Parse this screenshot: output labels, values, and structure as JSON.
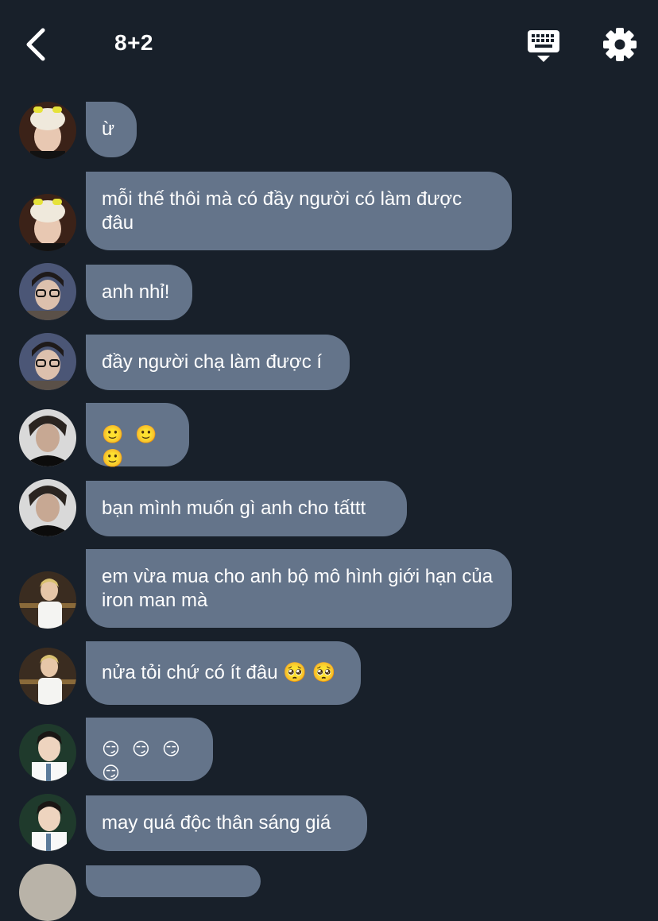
{
  "header": {
    "title": "8+2"
  },
  "messages": [
    {
      "text": "ừ",
      "avatar": "avatar-user-1"
    },
    {
      "text": "mỗi thế thôi mà có đầy người có làm được đâu",
      "avatar": "avatar-user-1"
    },
    {
      "text": "anh nhỉ!",
      "avatar": "avatar-user-2"
    },
    {
      "text": "đầy người chạ làm được í",
      "avatar": "avatar-user-2"
    },
    {
      "text": "🙂 🙂 🙂",
      "avatar": "avatar-user-3"
    },
    {
      "text": "bạn mình muốn gì anh cho tấttt",
      "avatar": "avatar-user-3"
    },
    {
      "text": "em vừa mua cho anh bộ mô hình giới hạn của iron man mà",
      "avatar": "avatar-user-4"
    },
    {
      "text": "nửa tỏi chứ có ít đâu 🥺 🥺",
      "avatar": "avatar-user-4"
    },
    {
      "text": "😏 😏 😏 😏",
      "avatar": "avatar-user-5"
    },
    {
      "text": "may quá độc thân sáng giá",
      "avatar": "avatar-user-5"
    }
  ],
  "colors": {
    "background": "#18202a",
    "bubble": "#64748a",
    "text": "#ffffff"
  }
}
